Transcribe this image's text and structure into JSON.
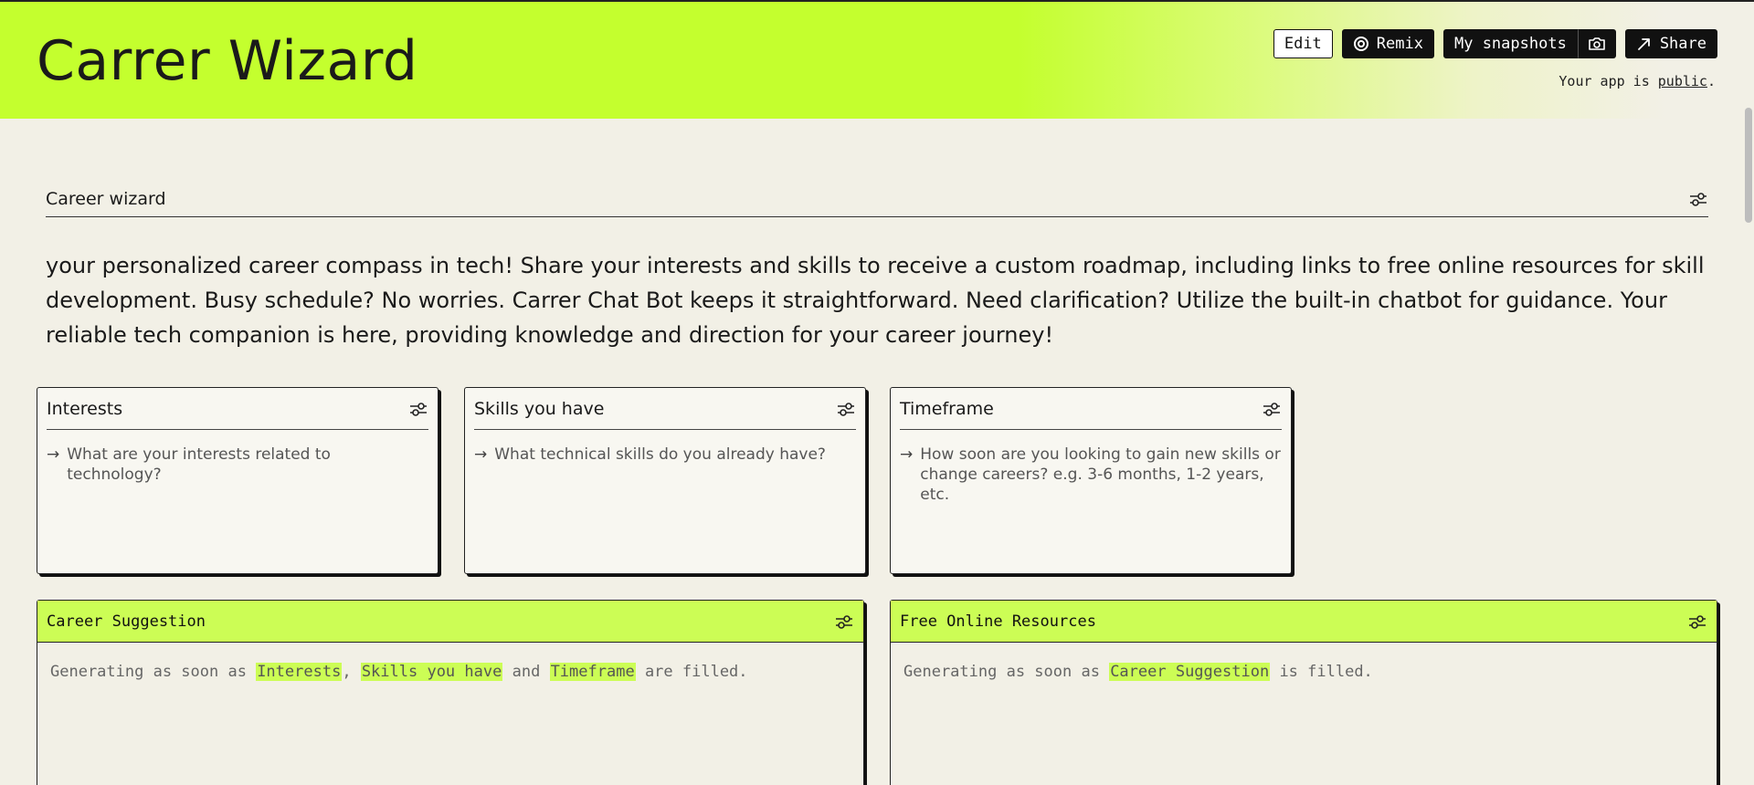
{
  "header": {
    "title": "Carrer Wizard",
    "edit_label": "Edit",
    "remix_label": "Remix",
    "snapshots_label": "My snapshots",
    "share_label": "Share",
    "visibility_prefix": "Your app is ",
    "visibility_link": "public",
    "visibility_suffix": ".",
    "accent_color": "#c4ff2e"
  },
  "section": {
    "title": "Career wizard",
    "intro": "your personalized career compass in tech! Share your interests and skills to receive a custom roadmap, including links to free online resources for skill development. Busy schedule? No worries. Carrer Chat Bot keeps it straightforward. Need clarification? Utilize the built-in chatbot for guidance. Your reliable tech companion is here, providing knowledge and direction for your career journey!"
  },
  "inputs": [
    {
      "title": "Interests",
      "prompt": "What are your interests related to technology?"
    },
    {
      "title": "Skills you have",
      "prompt": "What technical skills do you already have?"
    },
    {
      "title": "Timeframe",
      "prompt": "How soon are you looking to gain new skills or change careers? e.g. 3-6 months, 1-2 years, etc."
    }
  ],
  "outputs": [
    {
      "title": "Career Suggestion",
      "status_prefix": "Generating as soon as",
      "dep1": "Interests",
      "comma": ",",
      "dep2": "Skills you have",
      "and": "and",
      "dep3": "Timeframe",
      "status_suffix": "are filled."
    },
    {
      "title": "Free Online Resources",
      "status_prefix": "Generating as soon as",
      "dep1": "Career Suggestion",
      "status_suffix": "is filled."
    }
  ],
  "icons": {
    "settings": "settings-sliders-icon",
    "arrow": "arrow-right-icon",
    "remix": "remix-icon",
    "camera": "camera-icon",
    "share": "share-arrow-icon"
  }
}
